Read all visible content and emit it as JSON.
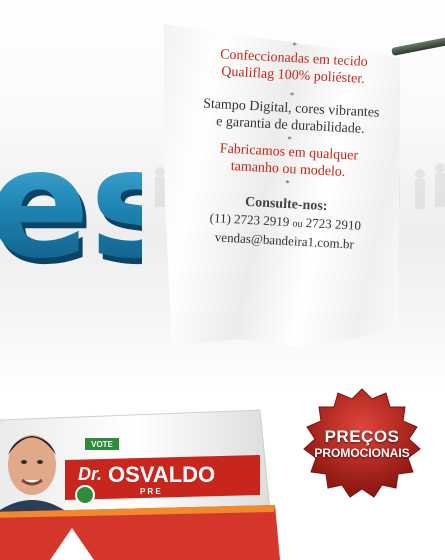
{
  "flag": {
    "stars": [
      "*",
      "*",
      "*",
      "*"
    ],
    "line1": "Confeccionadas em tecido",
    "line2": "Qualiflag 100% poliéster.",
    "line3": "Stampo Digital, cores vibrantes",
    "line4": "e garantia de durabilidade.",
    "line5": "Fabricamos em qualquer",
    "line6": "tamanho ou modelo.",
    "consult": "Consulte-nos:",
    "phone1": "(11) 2723 2919",
    "phone_sep": "ou",
    "phone2": "2723 2910",
    "email": "vendas@bandeira1.com.br"
  },
  "letters": {
    "text": "es"
  },
  "badge": {
    "line1": "PREÇOS",
    "line2": "PROMOCIONAIS"
  },
  "campaign": {
    "vote": "VOTE",
    "title": "Dr.",
    "name": "OSVALDO",
    "sub": "P R E"
  },
  "colors": {
    "red": "#c8251c",
    "blue": "#1f86b5",
    "green": "#2e8b3a"
  }
}
